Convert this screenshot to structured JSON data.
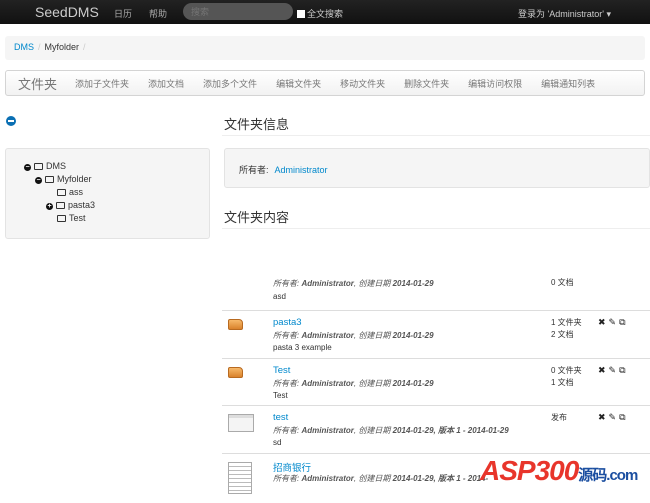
{
  "nav": {
    "brand": "SeedDMS",
    "calendar": "日历",
    "help": "帮助",
    "search_placeholder": "搜索",
    "fulltext": "全文搜索",
    "user": "登录为 'Administrator' ▾"
  },
  "breadcrumb": [
    "DMS",
    "Myfolder"
  ],
  "toolbar": {
    "title": "文件夹",
    "items": [
      "添加子文件夹",
      "添加文档",
      "添加多个文件",
      "编辑文件夹",
      "移动文件夹",
      "删除文件夹",
      "编辑访问权限",
      "编辑通知列表"
    ]
  },
  "tree": [
    {
      "label": "DMS",
      "toggle": "−"
    },
    {
      "label": "Myfolder",
      "toggle": "−"
    },
    {
      "label": "ass",
      "toggle": ""
    },
    {
      "label": "pasta3",
      "toggle": "+"
    },
    {
      "label": "Test",
      "toggle": ""
    }
  ],
  "info": {
    "title": "文件夹信息",
    "owner_label": "所有者:",
    "owner": "Administrator"
  },
  "content": {
    "title": "文件夹内容",
    "rows": [
      {
        "name": "",
        "meta_label": "所有者:",
        "owner": "Administrator",
        "date_label": "创建日期",
        "date": "2014-01-29",
        "version": "",
        "desc": "asd",
        "status": [
          "0 文档"
        ],
        "icon": "folder-icon"
      },
      {
        "name": "pasta3",
        "meta_label": "所有者:",
        "owner": "Administrator",
        "date_label": "创建日期",
        "date": "2014-01-29",
        "version": "",
        "desc": "pasta 3 example",
        "status": [
          "1 文件夹",
          "2 文档"
        ],
        "icon": "folder-icon"
      },
      {
        "name": "Test",
        "meta_label": "所有者:",
        "owner": "Administrator",
        "date_label": "创建日期",
        "date": "2014-01-29",
        "version": "",
        "desc": "Test",
        "status": [
          "0 文件夹",
          "1 文档"
        ],
        "icon": "folder-icon"
      },
      {
        "name": "test",
        "meta_label": "所有者:",
        "owner": "Administrator",
        "date_label": "创建日期",
        "date": "2014-01-29",
        "version": ", 版本 1 - 2014-01-29",
        "desc": "sd",
        "status": [
          "发布"
        ],
        "icon": "document-thumbnail-icon"
      },
      {
        "name": "招商银行",
        "meta_label": "所有者:",
        "owner": "Administrator",
        "date_label": "创建日期",
        "date": "2014-01-29",
        "version": ", 版本 1 - 2014-",
        "desc": "",
        "status": [],
        "icon": "document-thumbnail-icon"
      }
    ]
  },
  "actions": {
    "delete": "✖",
    "edit": "✎",
    "copy": "⧉"
  },
  "watermark": "ASP300源码.com"
}
